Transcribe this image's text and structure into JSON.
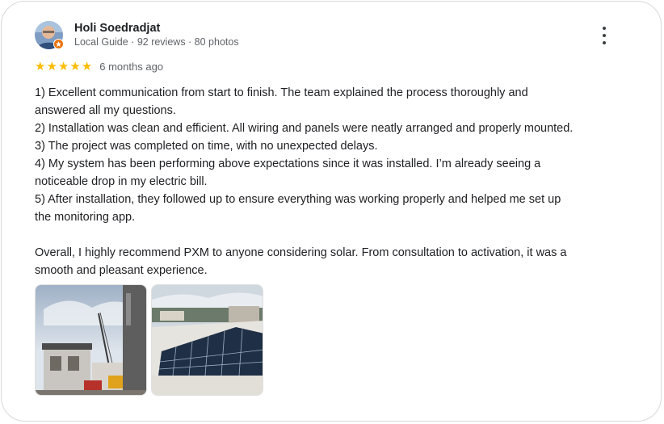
{
  "review": {
    "author": "Holi Soedradjat",
    "meta": "Local Guide · 92 reviews · 80 photos",
    "rating": 5,
    "stars": [
      "★",
      "★",
      "★",
      "★",
      "★"
    ],
    "time": "6 months ago",
    "lines": [
      "1) Excellent communication from start to finish. The team explained the process thoroughly and",
      "answered all my questions.",
      "2) Installation was clean and efficient. All wiring and panels were neatly arranged and properly mounted.",
      "3) The project was completed on time, with no unexpected delays.",
      "4) My system has been performing above expectations since it was installed. I’m already seeing a",
      "noticeable drop in my electric bill.",
      "5) After installation, they followed up to ensure everything was working properly and helped me set up",
      "the monitoring app.",
      "",
      "Overall, I highly recommend PXM to anyone considering solar. From consultation to activation, it was a",
      "smooth and pleasant experience."
    ],
    "photos": [
      "review-photo-house-crane",
      "review-photo-solar-panels"
    ]
  },
  "icons": {
    "more": "more-vert-icon",
    "badge": "local-guide-badge-icon"
  },
  "colors": {
    "star": "#fbbc04",
    "badge": "#e8710a",
    "text": "#202124",
    "secondary": "#5f6368"
  }
}
